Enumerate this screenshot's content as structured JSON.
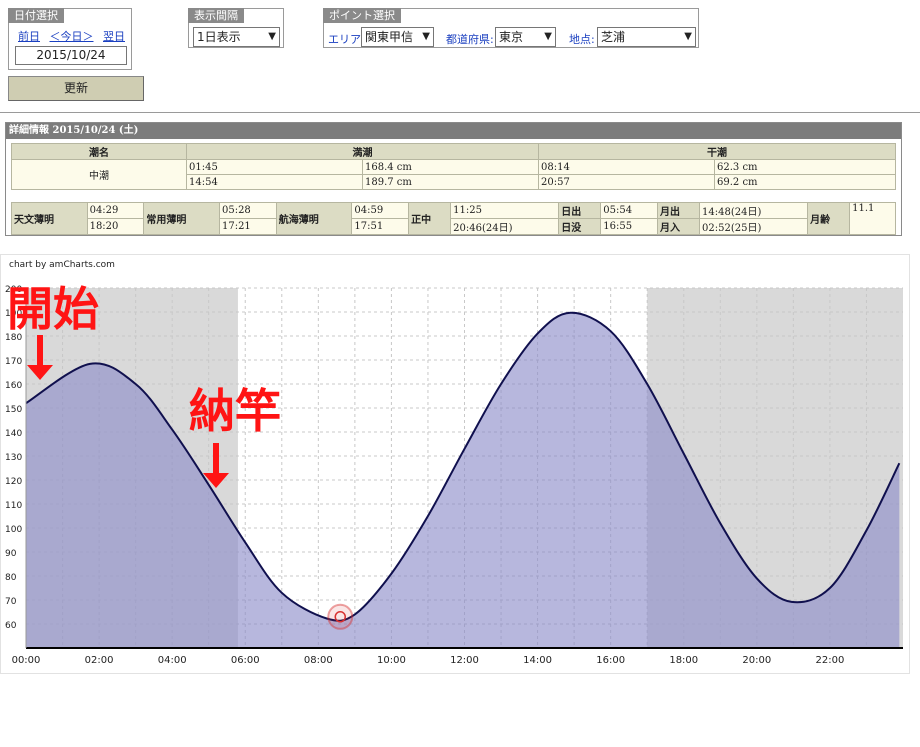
{
  "date_select": {
    "legend": "日付選択",
    "prev": "前日",
    "today": "＜今日＞",
    "next": "翌日",
    "date": "2015/10/24"
  },
  "interval": {
    "legend": "表示間隔",
    "value": "1日表示"
  },
  "point": {
    "legend": "ポイント選択",
    "area_label": "エリア:",
    "area_value": "関東甲信",
    "pref_label": "都道府県:",
    "pref_value": "東京",
    "spot_label": "地点:",
    "spot_value": "芝浦"
  },
  "update_button": "更新",
  "detail": {
    "title": "詳細情報  2015/10/24 (土)",
    "headers": {
      "tide_name": "潮名",
      "high": "満潮",
      "low": "干潮"
    },
    "tide_name": "中潮",
    "high": [
      {
        "time": "01:45",
        "level": "168.4 cm"
      },
      {
        "time": "14:54",
        "level": "189.7 cm"
      }
    ],
    "low": [
      {
        "time": "08:14",
        "level": "62.3 cm"
      },
      {
        "time": "20:57",
        "level": "69.2 cm"
      }
    ],
    "twilight": [
      {
        "label": "天文薄明",
        "values": [
          "04:29",
          "18:20"
        ]
      },
      {
        "label": "常用薄明",
        "values": [
          "05:28",
          "17:21"
        ]
      },
      {
        "label": "航海薄明",
        "values": [
          "04:59",
          "17:51"
        ]
      },
      {
        "label": "正中",
        "values": [
          "11:25",
          "20:46(24日)"
        ]
      }
    ],
    "sun": {
      "rise_label": "日出",
      "rise": "05:54",
      "set_label": "日没",
      "set": "16:55"
    },
    "moon": {
      "rise_label": "月出",
      "rise": "14:48(24日)",
      "set_label": "月入",
      "set": "02:52(25日)"
    },
    "moon_age_label": "月齢",
    "moon_age": "11.1"
  },
  "chart_credit": "chart by amCharts.com",
  "annotations": {
    "start": "開始",
    "finish": "納竿"
  },
  "colors": {
    "night_shade": "#d9d9d9",
    "area_fill": "#8a8ac8",
    "line": "#10104e",
    "annotation": "#ff1414",
    "marker": "#d83030"
  },
  "chart_data": {
    "type": "area",
    "title": "",
    "xlabel": "",
    "ylabel": "",
    "x_ticks": [
      "00:00",
      "02:00",
      "04:00",
      "06:00",
      "08:00",
      "10:00",
      "12:00",
      "14:00",
      "16:00",
      "18:00",
      "20:00",
      "22:00"
    ],
    "y_ticks": [
      60,
      70,
      80,
      90,
      100,
      110,
      120,
      130,
      140,
      150,
      160,
      170,
      180,
      190,
      200
    ],
    "ylim": [
      50,
      200
    ],
    "xlim_hours": [
      0,
      24
    ],
    "grid": true,
    "night_shading_hours": [
      [
        0,
        5.8
      ],
      [
        17,
        24
      ]
    ],
    "series": [
      {
        "x_hours": [
          0,
          1.75,
          3,
          4,
          5,
          6,
          7,
          8.23,
          9,
          10,
          11,
          12,
          13,
          14,
          14.9,
          16,
          17,
          18,
          19,
          20,
          20.95,
          22,
          23,
          23.9
        ],
        "y": [
          152,
          168.4,
          160,
          141,
          118,
          94,
          73,
          62.3,
          64,
          81,
          105,
          133,
          160,
          181,
          189.7,
          182,
          160,
          131,
          102,
          79,
          69.2,
          75,
          99,
          127
        ]
      }
    ],
    "cursor_marker": {
      "x_hours": 8.6,
      "y": 63
    }
  }
}
